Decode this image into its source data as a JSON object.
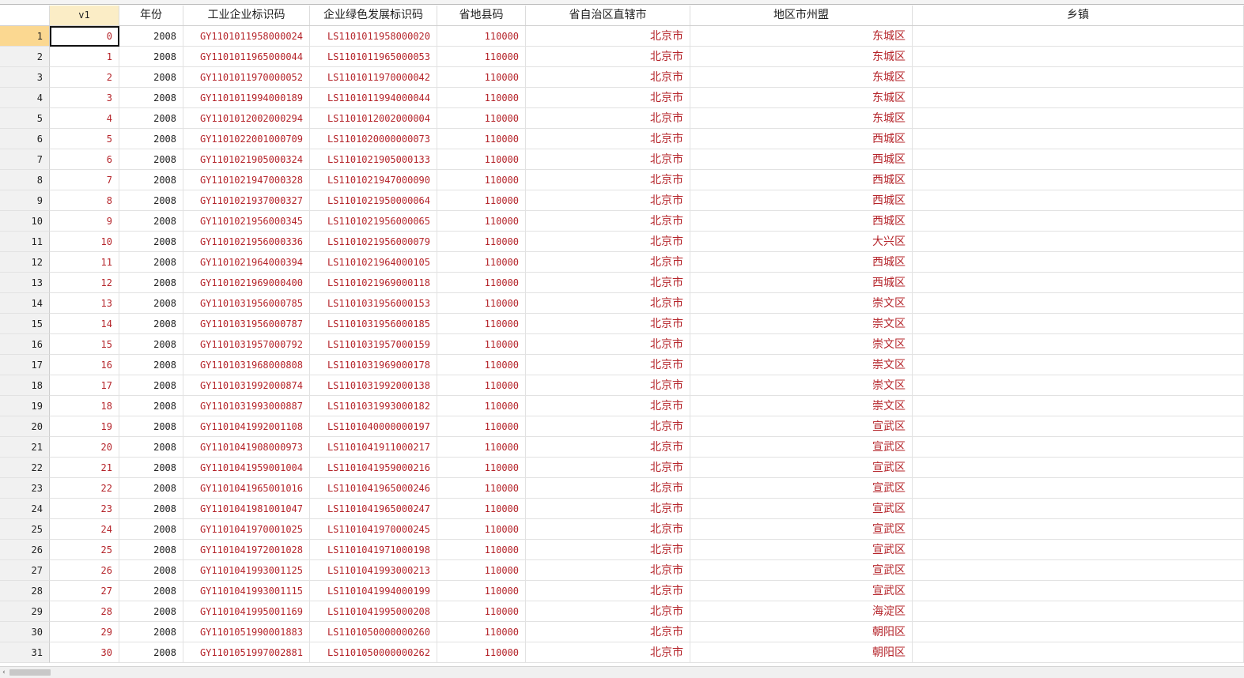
{
  "columns": [
    {
      "label": "v1"
    },
    {
      "label": "年份"
    },
    {
      "label": "工业企业标识码"
    },
    {
      "label": "企业绿色发展标识码"
    },
    {
      "label": "省地县码"
    },
    {
      "label": "省自治区直辖市"
    },
    {
      "label": "地区市州盟"
    },
    {
      "label": "乡镇"
    }
  ],
  "rows": [
    {
      "n": "1",
      "v1": "0",
      "year": "2008",
      "gy": "GY1101011958000024",
      "ls": "LS1101011958000020",
      "code": "110000",
      "prov": "北京市",
      "dist": "东城区",
      "town": ""
    },
    {
      "n": "2",
      "v1": "1",
      "year": "2008",
      "gy": "GY1101011965000044",
      "ls": "LS1101011965000053",
      "code": "110000",
      "prov": "北京市",
      "dist": "东城区",
      "town": ""
    },
    {
      "n": "3",
      "v1": "2",
      "year": "2008",
      "gy": "GY1101011970000052",
      "ls": "LS1101011970000042",
      "code": "110000",
      "prov": "北京市",
      "dist": "东城区",
      "town": ""
    },
    {
      "n": "4",
      "v1": "3",
      "year": "2008",
      "gy": "GY1101011994000189",
      "ls": "LS1101011994000044",
      "code": "110000",
      "prov": "北京市",
      "dist": "东城区",
      "town": ""
    },
    {
      "n": "5",
      "v1": "4",
      "year": "2008",
      "gy": "GY1101012002000294",
      "ls": "LS1101012002000004",
      "code": "110000",
      "prov": "北京市",
      "dist": "东城区",
      "town": ""
    },
    {
      "n": "6",
      "v1": "5",
      "year": "2008",
      "gy": "GY1101022001000709",
      "ls": "LS1101020000000073",
      "code": "110000",
      "prov": "北京市",
      "dist": "西城区",
      "town": ""
    },
    {
      "n": "7",
      "v1": "6",
      "year": "2008",
      "gy": "GY1101021905000324",
      "ls": "LS1101021905000133",
      "code": "110000",
      "prov": "北京市",
      "dist": "西城区",
      "town": ""
    },
    {
      "n": "8",
      "v1": "7",
      "year": "2008",
      "gy": "GY1101021947000328",
      "ls": "LS1101021947000090",
      "code": "110000",
      "prov": "北京市",
      "dist": "西城区",
      "town": ""
    },
    {
      "n": "9",
      "v1": "8",
      "year": "2008",
      "gy": "GY1101021937000327",
      "ls": "LS1101021950000064",
      "code": "110000",
      "prov": "北京市",
      "dist": "西城区",
      "town": ""
    },
    {
      "n": "10",
      "v1": "9",
      "year": "2008",
      "gy": "GY1101021956000345",
      "ls": "LS1101021956000065",
      "code": "110000",
      "prov": "北京市",
      "dist": "西城区",
      "town": ""
    },
    {
      "n": "11",
      "v1": "10",
      "year": "2008",
      "gy": "GY1101021956000336",
      "ls": "LS1101021956000079",
      "code": "110000",
      "prov": "北京市",
      "dist": "大兴区",
      "town": ""
    },
    {
      "n": "12",
      "v1": "11",
      "year": "2008",
      "gy": "GY1101021964000394",
      "ls": "LS1101021964000105",
      "code": "110000",
      "prov": "北京市",
      "dist": "西城区",
      "town": ""
    },
    {
      "n": "13",
      "v1": "12",
      "year": "2008",
      "gy": "GY1101021969000400",
      "ls": "LS1101021969000118",
      "code": "110000",
      "prov": "北京市",
      "dist": "西城区",
      "town": ""
    },
    {
      "n": "14",
      "v1": "13",
      "year": "2008",
      "gy": "GY1101031956000785",
      "ls": "LS1101031956000153",
      "code": "110000",
      "prov": "北京市",
      "dist": "崇文区",
      "town": ""
    },
    {
      "n": "15",
      "v1": "14",
      "year": "2008",
      "gy": "GY1101031956000787",
      "ls": "LS1101031956000185",
      "code": "110000",
      "prov": "北京市",
      "dist": "崇文区",
      "town": ""
    },
    {
      "n": "16",
      "v1": "15",
      "year": "2008",
      "gy": "GY1101031957000792",
      "ls": "LS1101031957000159",
      "code": "110000",
      "prov": "北京市",
      "dist": "崇文区",
      "town": ""
    },
    {
      "n": "17",
      "v1": "16",
      "year": "2008",
      "gy": "GY1101031968000808",
      "ls": "LS1101031969000178",
      "code": "110000",
      "prov": "北京市",
      "dist": "崇文区",
      "town": ""
    },
    {
      "n": "18",
      "v1": "17",
      "year": "2008",
      "gy": "GY1101031992000874",
      "ls": "LS1101031992000138",
      "code": "110000",
      "prov": "北京市",
      "dist": "崇文区",
      "town": ""
    },
    {
      "n": "19",
      "v1": "18",
      "year": "2008",
      "gy": "GY1101031993000887",
      "ls": "LS1101031993000182",
      "code": "110000",
      "prov": "北京市",
      "dist": "崇文区",
      "town": ""
    },
    {
      "n": "20",
      "v1": "19",
      "year": "2008",
      "gy": "GY1101041992001108",
      "ls": "LS1101040000000197",
      "code": "110000",
      "prov": "北京市",
      "dist": "宣武区",
      "town": ""
    },
    {
      "n": "21",
      "v1": "20",
      "year": "2008",
      "gy": "GY1101041908000973",
      "ls": "LS1101041911000217",
      "code": "110000",
      "prov": "北京市",
      "dist": "宣武区",
      "town": ""
    },
    {
      "n": "22",
      "v1": "21",
      "year": "2008",
      "gy": "GY1101041959001004",
      "ls": "LS1101041959000216",
      "code": "110000",
      "prov": "北京市",
      "dist": "宣武区",
      "town": ""
    },
    {
      "n": "23",
      "v1": "22",
      "year": "2008",
      "gy": "GY1101041965001016",
      "ls": "LS1101041965000246",
      "code": "110000",
      "prov": "北京市",
      "dist": "宣武区",
      "town": ""
    },
    {
      "n": "24",
      "v1": "23",
      "year": "2008",
      "gy": "GY1101041981001047",
      "ls": "LS1101041965000247",
      "code": "110000",
      "prov": "北京市",
      "dist": "宣武区",
      "town": ""
    },
    {
      "n": "25",
      "v1": "24",
      "year": "2008",
      "gy": "GY1101041970001025",
      "ls": "LS1101041970000245",
      "code": "110000",
      "prov": "北京市",
      "dist": "宣武区",
      "town": ""
    },
    {
      "n": "26",
      "v1": "25",
      "year": "2008",
      "gy": "GY1101041972001028",
      "ls": "LS1101041971000198",
      "code": "110000",
      "prov": "北京市",
      "dist": "宣武区",
      "town": ""
    },
    {
      "n": "27",
      "v1": "26",
      "year": "2008",
      "gy": "GY1101041993001125",
      "ls": "LS1101041993000213",
      "code": "110000",
      "prov": "北京市",
      "dist": "宣武区",
      "town": ""
    },
    {
      "n": "28",
      "v1": "27",
      "year": "2008",
      "gy": "GY1101041993001115",
      "ls": "LS1101041994000199",
      "code": "110000",
      "prov": "北京市",
      "dist": "宣武区",
      "town": ""
    },
    {
      "n": "29",
      "v1": "28",
      "year": "2008",
      "gy": "GY1101041995001169",
      "ls": "LS1101041995000208",
      "code": "110000",
      "prov": "北京市",
      "dist": "海淀区",
      "town": ""
    },
    {
      "n": "30",
      "v1": "29",
      "year": "2008",
      "gy": "GY1101051990001883",
      "ls": "LS1101050000000260",
      "code": "110000",
      "prov": "北京市",
      "dist": "朝阳区",
      "town": ""
    },
    {
      "n": "31",
      "v1": "30",
      "year": "2008",
      "gy": "GY1101051997002881",
      "ls": "LS1101050000000262",
      "code": "110000",
      "prov": "北京市",
      "dist": "朝阳区",
      "town": ""
    }
  ],
  "colors": {
    "value_text": "#b5242a",
    "selected_header": "#fbedc6",
    "active_row_number": "#fbd891"
  },
  "icons": {
    "scroll_left": "chevron-left-icon"
  },
  "glyphs": {
    "scroll_left": "‹"
  }
}
